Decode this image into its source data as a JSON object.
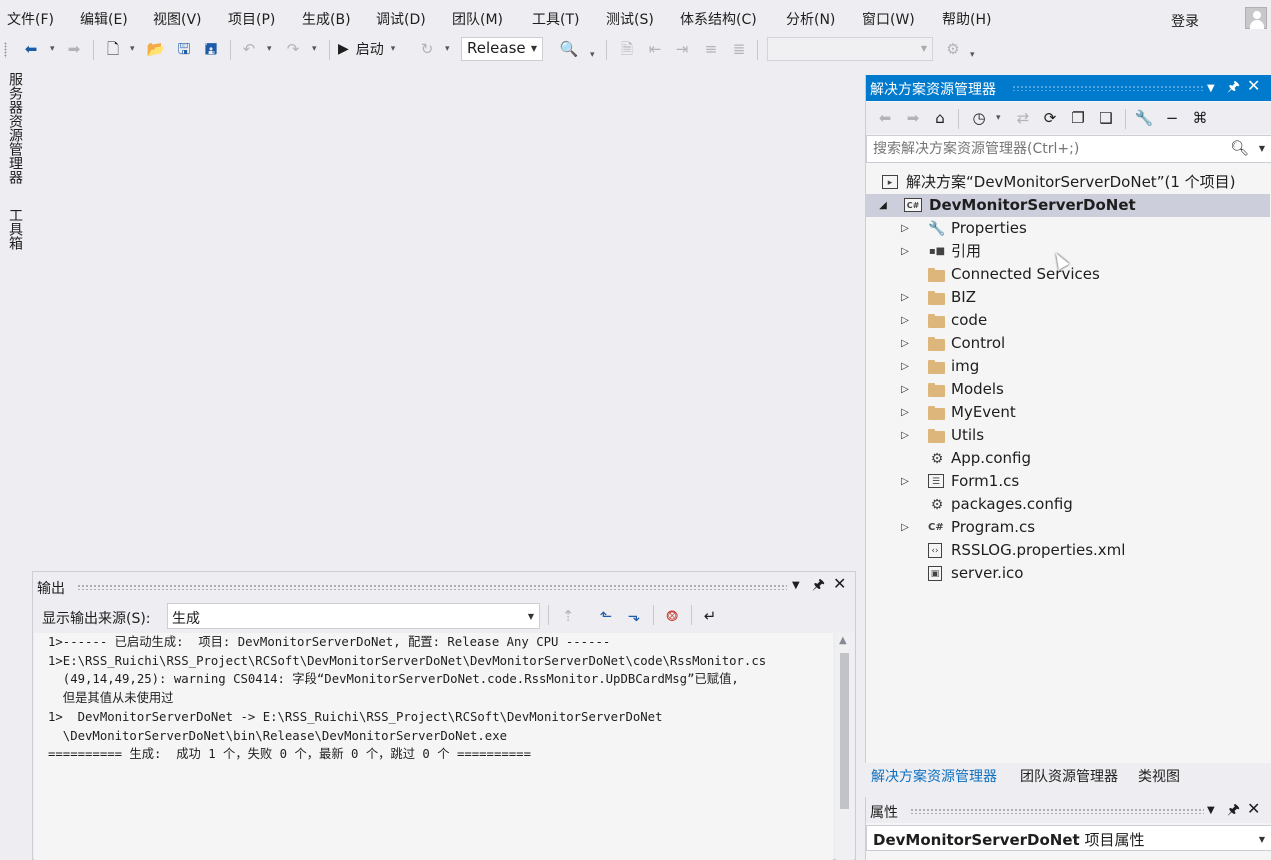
{
  "menubar": {
    "items": [
      "文件(F)",
      "编辑(E)",
      "视图(V)",
      "项目(P)",
      "生成(B)",
      "调试(D)",
      "团队(M)",
      "工具(T)",
      "测试(S)",
      "体系结构(C)",
      "分析(N)",
      "窗口(W)",
      "帮助(H)"
    ],
    "login": "登录"
  },
  "toolbar": {
    "start_label": "启动",
    "configuration": "Release",
    "platform": ""
  },
  "left_strip": {
    "tabs": [
      "服务器资源管理器",
      "工具箱"
    ]
  },
  "output": {
    "title": "输出",
    "source_label": "显示输出来源(S):",
    "source_value": "生成",
    "lines": [
      "1>------ 已启动生成:  项目: DevMonitorServerDoNet, 配置: Release Any CPU ------",
      "1>E:\\RSS_Ruichi\\RSS_Project\\RCSoft\\DevMonitorServerDoNet\\DevMonitorServerDoNet\\code\\RssMonitor.cs",
      "  (49,14,49,25): warning CS0414: 字段“DevMonitorServerDoNet.code.RssMonitor.UpDBCardMsg”已赋值,",
      "  但是其值从未使用过",
      "1>  DevMonitorServerDoNet -> E:\\RSS_Ruichi\\RSS_Project\\RCSoft\\DevMonitorServerDoNet",
      "  \\DevMonitorServerDoNet\\bin\\Release\\DevMonitorServerDoNet.exe",
      "========== 生成:  成功 1 个，失败 0 个，最新 0 个，跳过 0 个 =========="
    ]
  },
  "solution_explorer": {
    "title": "解决方案资源管理器",
    "search_placeholder": "搜索解决方案资源管理器(Ctrl+;)",
    "solution": "解决方案“DevMonitorServerDoNet”(1 个项目)",
    "project": "DevMonitorServerDoNet",
    "items": [
      {
        "label": "Properties",
        "icon": "wrench-icon",
        "expandable": true
      },
      {
        "label": "引用",
        "icon": "reference-icon",
        "expandable": true
      },
      {
        "label": "Connected Services",
        "icon": "folder-icon",
        "expandable": false
      },
      {
        "label": "BIZ",
        "icon": "folder-icon",
        "expandable": true
      },
      {
        "label": "code",
        "icon": "folder-icon",
        "expandable": true
      },
      {
        "label": "Control",
        "icon": "folder-icon",
        "expandable": true
      },
      {
        "label": "img",
        "icon": "folder-icon",
        "expandable": true
      },
      {
        "label": "Models",
        "icon": "folder-icon",
        "expandable": true
      },
      {
        "label": "MyEvent",
        "icon": "folder-icon",
        "expandable": true
      },
      {
        "label": "Utils",
        "icon": "folder-icon",
        "expandable": true
      },
      {
        "label": "App.config",
        "icon": "config-file-icon",
        "expandable": false
      },
      {
        "label": "Form1.cs",
        "icon": "form-icon",
        "expandable": true
      },
      {
        "label": "packages.config",
        "icon": "config-file-icon",
        "expandable": false
      },
      {
        "label": "Program.cs",
        "icon": "csharp-file-icon",
        "expandable": true
      },
      {
        "label": "RSSLOG.properties.xml",
        "icon": "xml-file-icon",
        "expandable": false
      },
      {
        "label": "server.ico",
        "icon": "image-file-icon",
        "expandable": false
      }
    ],
    "tabs": [
      "解决方案资源管理器",
      "团队资源管理器",
      "类视图"
    ],
    "active_tab": 0
  },
  "properties": {
    "title": "属性",
    "object_name": "DevMonitorServerDoNet",
    "object_type": "项目属性"
  },
  "colors": {
    "accent": "#007acc",
    "selection": "#cccedb",
    "folder": "#dcb67a"
  }
}
